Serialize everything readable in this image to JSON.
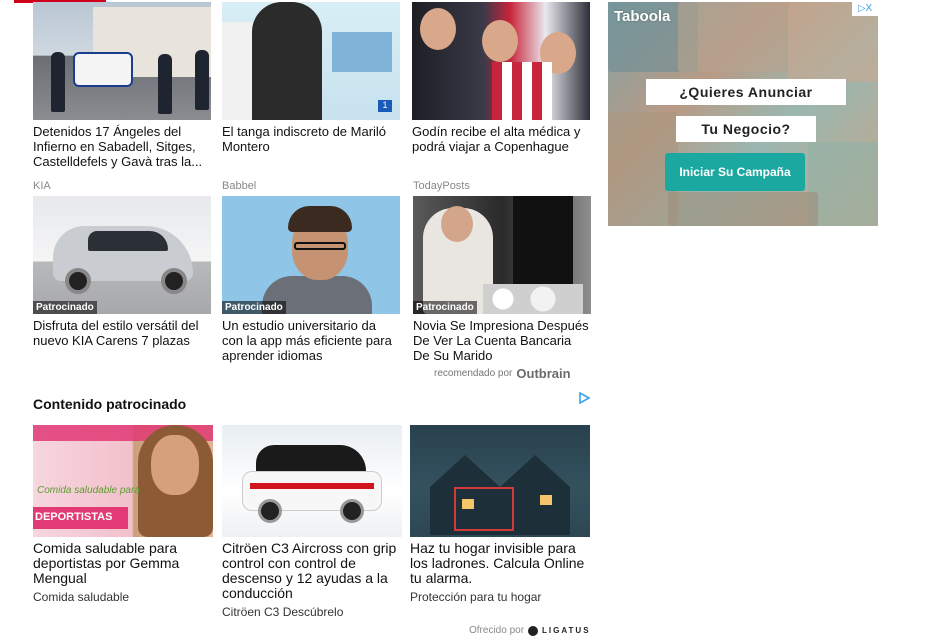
{
  "top_row": [
    {
      "title": "Detenidos 17 Ángeles del Infierno en Sabadell, Sitges, Castelldefels y Gavà tras la..."
    },
    {
      "title": "El tanga indiscreto de Mariló Montero"
    },
    {
      "title": "Godín recibe el alta médica y podrá viajar a Copenhague"
    }
  ],
  "sponsored_row": [
    {
      "brand": "KIA",
      "tag": "Patrocinado",
      "title": "Disfruta del estilo versátil del nuevo KIA Carens 7 plazas"
    },
    {
      "brand": "Babbel",
      "tag": "Patrocinado",
      "title": "Un estudio universitario da con la app más eficiente para aprender idiomas"
    },
    {
      "brand": "TodayPosts",
      "tag": "Patrocinado",
      "title": "Novia Se Impresiona Después De Ver La Cuenta Bancaria De Su Marido"
    }
  ],
  "recommended": {
    "label": "recomendado por",
    "provider": "Outbrain"
  },
  "taboola_ad": {
    "logo": "Taboola",
    "line1": "¿Quieres Anunciar",
    "line2": "Tu Negocio?",
    "cta": "Iniciar Su Campaña",
    "adchoices": "▷X"
  },
  "section": {
    "title": "Contenido patrocinado"
  },
  "ligatus_row": [
    {
      "title": "Comida saludable para deportistas por Gemma Mengual",
      "desc": "Comida saludable",
      "thumb_text": "DEPORTISTAS",
      "thumb_script": "Comida saludable para"
    },
    {
      "title": "Citröen C3 Aircross con grip control con control de descenso y 12 ayudas a la conducción",
      "desc": "Citröen C3 Descúbrelo"
    },
    {
      "title": "Haz tu hogar invisible para los ladrones. Calcula Online tu alarma.",
      "desc": "Protección para tu hogar"
    }
  ],
  "offered": {
    "label": "Ofrecido por",
    "provider": "LIGATUS"
  },
  "colors": {
    "accent": "#d0021b",
    "cta": "#1aa8a0",
    "ligatus_pink": "#e13a74"
  }
}
